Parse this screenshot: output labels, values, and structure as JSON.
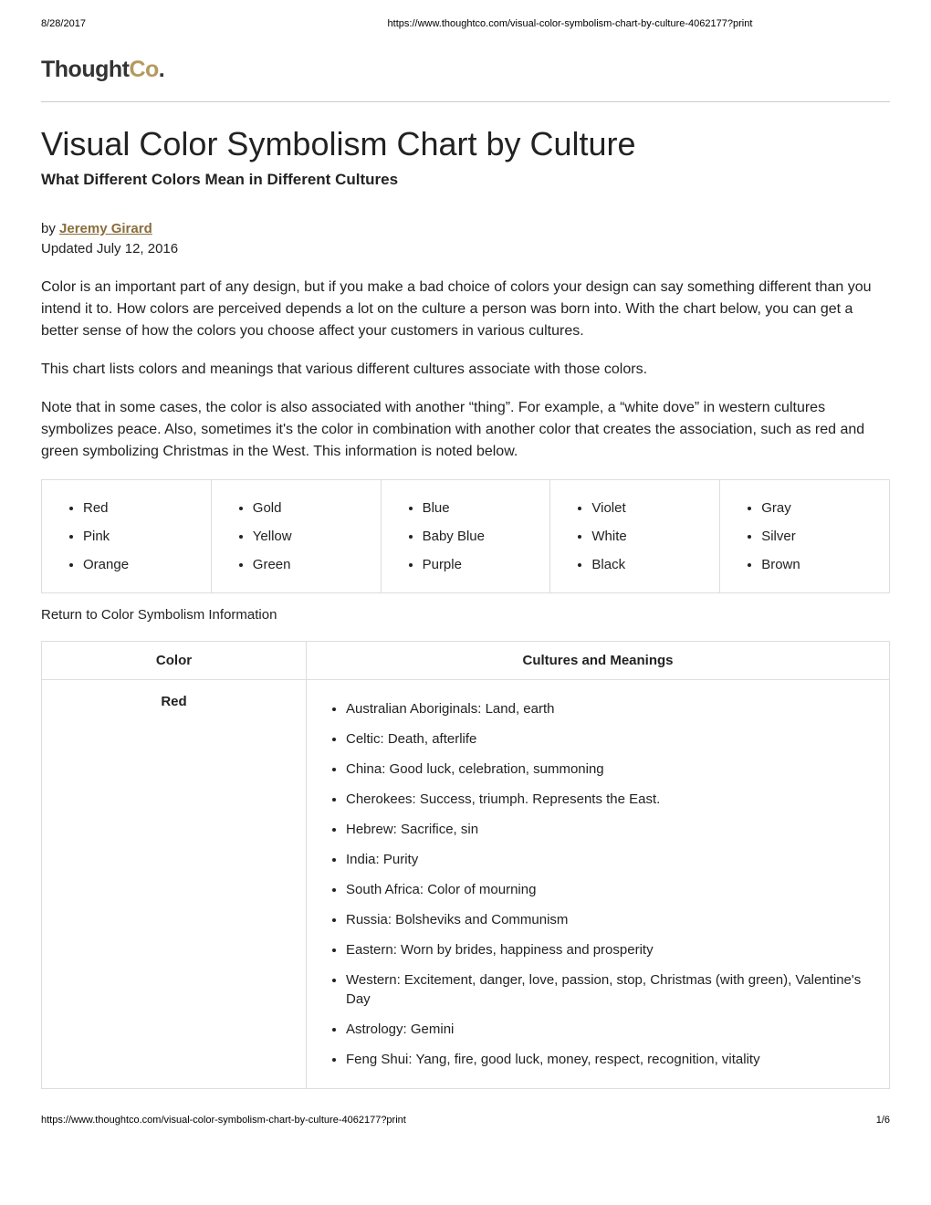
{
  "print_header": {
    "date": "8/28/2017",
    "url": "https://www.thoughtco.com/visual-color-symbolism-chart-by-culture-4062177?print"
  },
  "logo": {
    "thought": "Thought",
    "co": "Co",
    "dot": "."
  },
  "title": "Visual Color Symbolism Chart by Culture",
  "subtitle": "What Different Colors Mean in Different Cultures",
  "byline": {
    "by": "by ",
    "author": "Jeremy Girard"
  },
  "updated": "Updated July 12, 2016",
  "paragraphs": {
    "p1": "Color is an important part of any design, but if you make a bad choice of colors your design can say something different than you intend it to. How colors are perceived depends a lot on the culture a person was born into. With the chart below, you can get a better sense of how the colors you choose affect your customers in various cultures.",
    "p2": "This chart lists colors and meanings that various different cultures associate with those colors.",
    "p3": "Note that in some cases, the color is also associated with another “thing”. For example, a “white dove” in western cultures symbolizes peace. Also, sometimes it's the color in combination with another color that creates the association, such as red and green symbolizing Christmas in the West. This information is noted below."
  },
  "nav_columns": [
    [
      "Red",
      "Pink",
      "Orange"
    ],
    [
      "Gold",
      "Yellow",
      "Green"
    ],
    [
      "Blue",
      "Baby Blue",
      "Purple"
    ],
    [
      "Violet",
      "White",
      "Black"
    ],
    [
      "Gray",
      "Silver",
      "Brown"
    ]
  ],
  "return_link": "Return to Color Symbolism Information",
  "table": {
    "header_color": "Color",
    "header_meanings": "Cultures and Meanings",
    "rows": [
      {
        "color": "Red",
        "meanings": [
          "Australian Aboriginals: Land, earth",
          "Celtic: Death, afterlife",
          "China: Good luck, celebration, summoning",
          "Cherokees: Success, triumph. Represents the East.",
          "Hebrew: Sacrifice, sin",
          "India: Purity",
          "South Africa: Color of mourning",
          "Russia: Bolsheviks and Communism",
          "Eastern: Worn by brides, happiness and prosperity",
          "Western: Excitement, danger, love, passion, stop, Christmas (with green), Valentine's Day",
          "Astrology: Gemini",
          "Feng Shui: Yang, fire, good luck, money, respect, recognition, vitality"
        ]
      }
    ]
  },
  "print_footer": {
    "url": "https://www.thoughtco.com/visual-color-symbolism-chart-by-culture-4062177?print",
    "page": "1/6"
  }
}
